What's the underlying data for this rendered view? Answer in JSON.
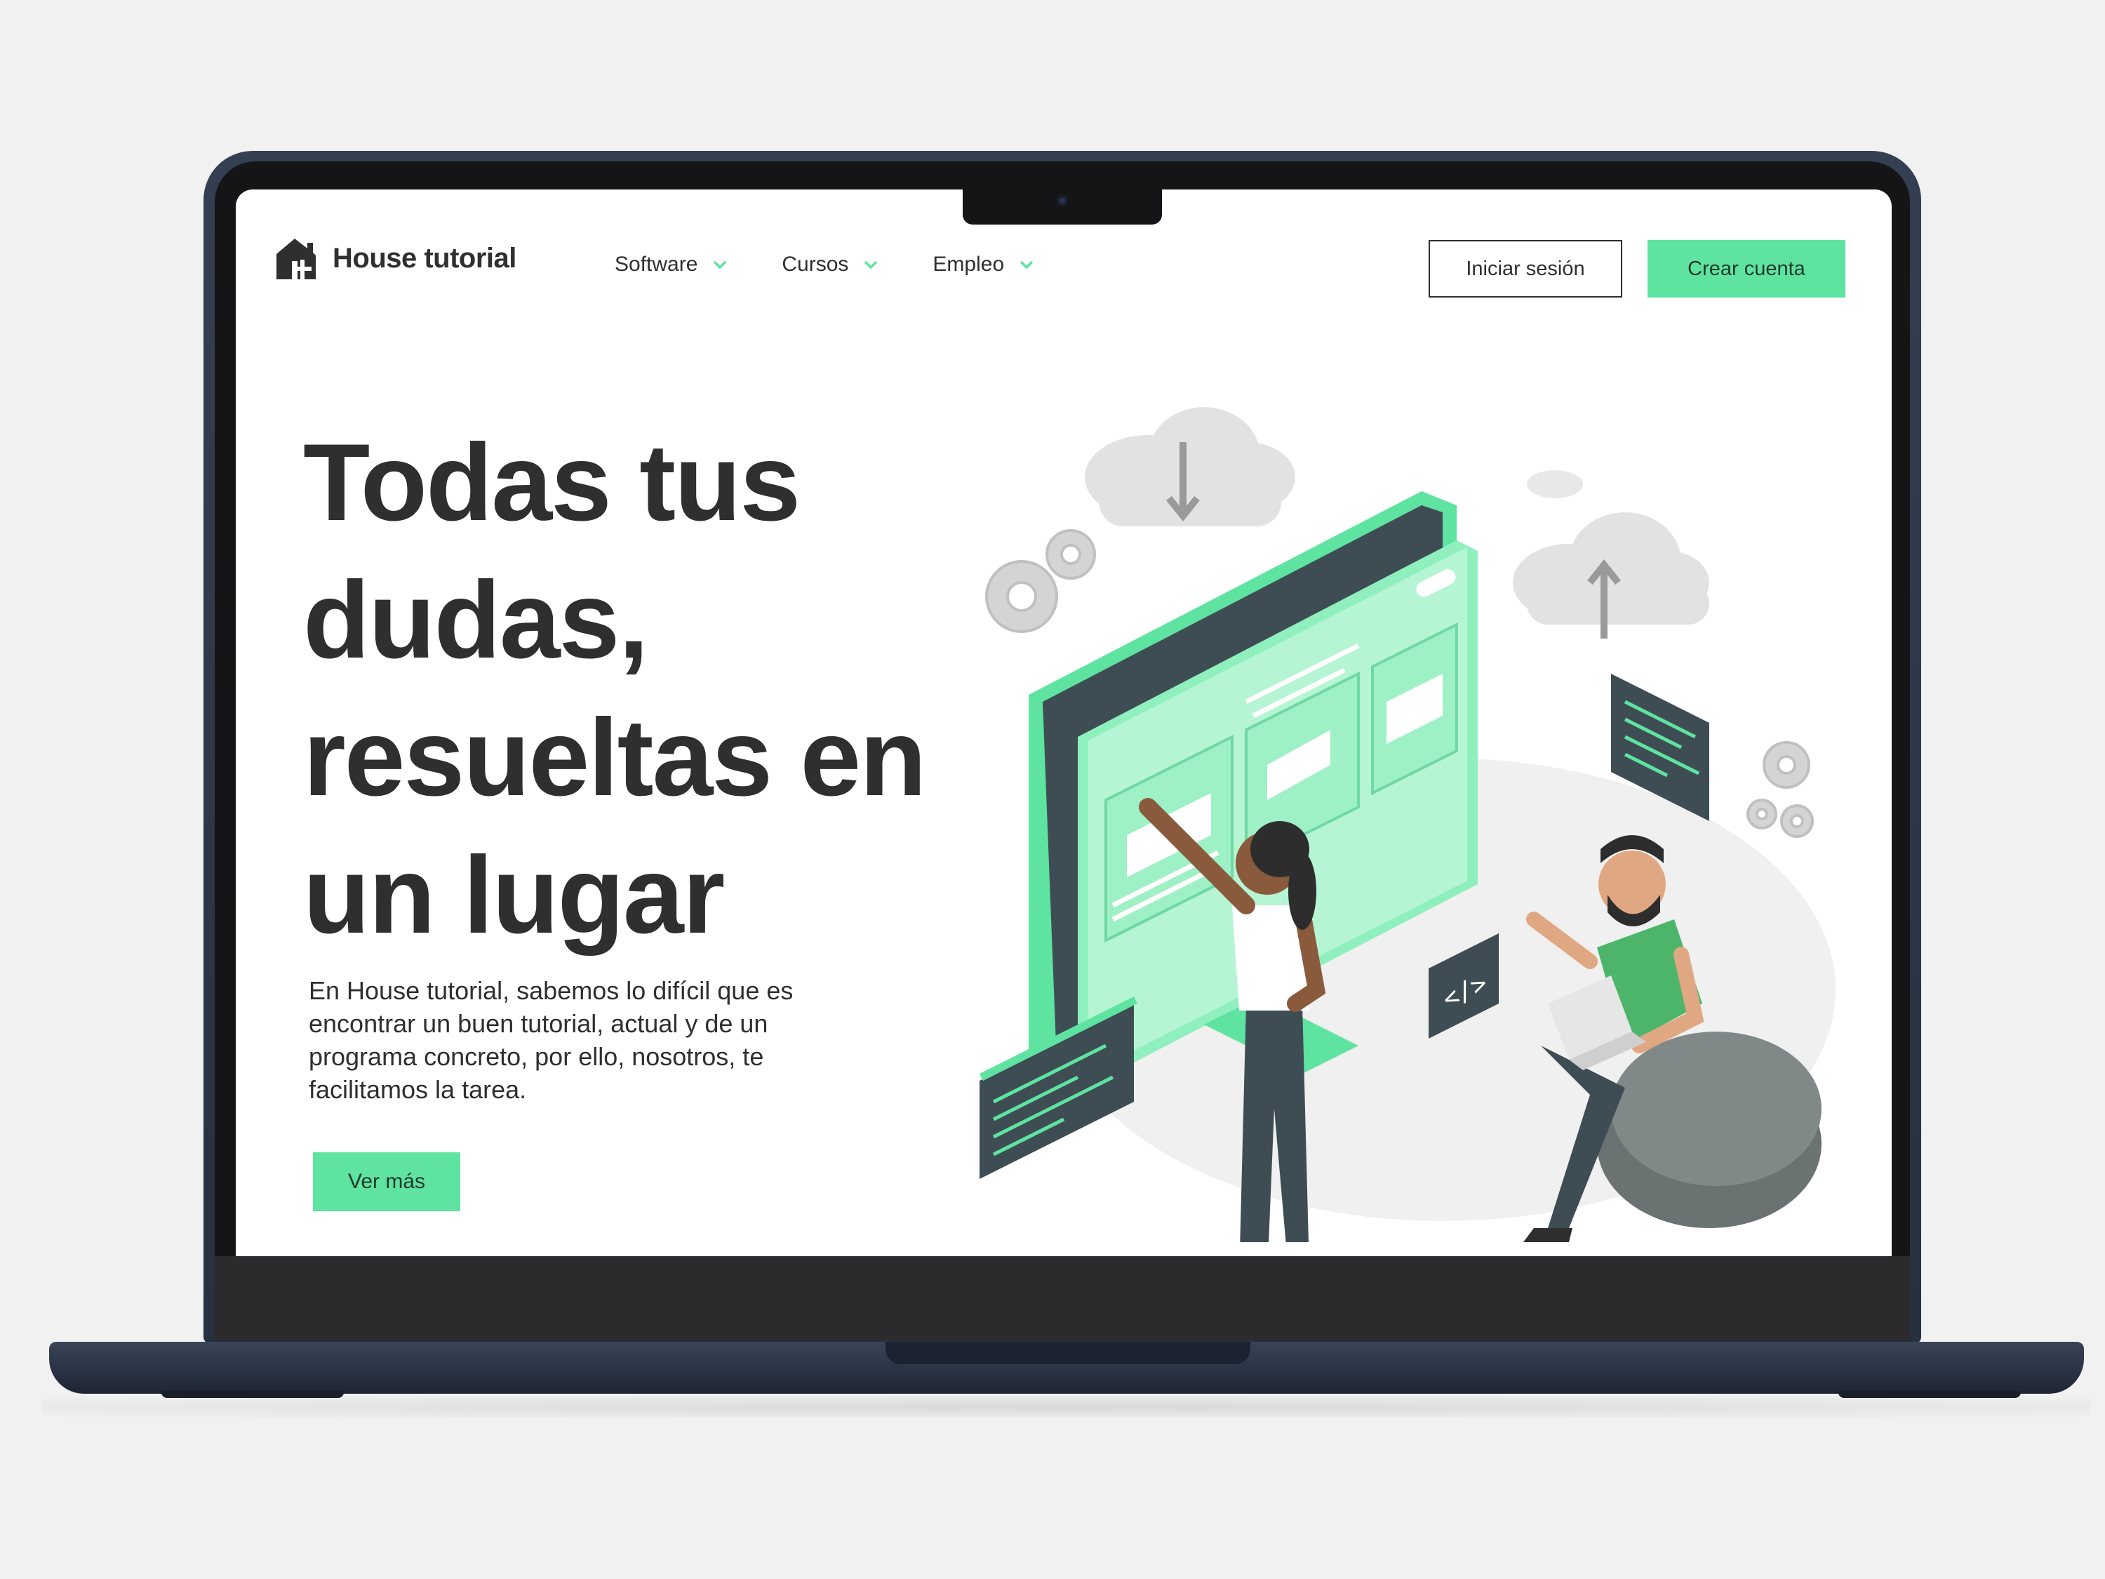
{
  "brand": {
    "name": "House tutorial",
    "accent": "#5fe3a1",
    "text_color": "#2f2f2f"
  },
  "nav": [
    {
      "label": "Software",
      "icon": "chevron-down-icon"
    },
    {
      "label": "Cursos",
      "icon": "chevron-down-icon"
    },
    {
      "label": "Empleo",
      "icon": "chevron-down-icon"
    }
  ],
  "header": {
    "login_label": "Iniciar sesión",
    "signup_label": "Crear cuenta"
  },
  "hero": {
    "title": "Todas tus dudas, resueltas en un lugar",
    "text": "En House tutorial, sabemos lo difícil que es encontrar un buen tutorial, actual y de un programa concreto, por ello, nosotros, te facilitamos la tarea.",
    "button_label": "Ver más"
  }
}
